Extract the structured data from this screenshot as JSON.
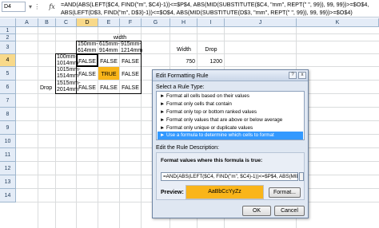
{
  "formula_bar": {
    "name_box": "D4",
    "fx": "fx",
    "formula": "=AND(ABS(LEFT($C4, FIND(\"m\", $C4)-1))<=$P$4, ABS(MID(SUBSTITUTE($C4, \"mm\", REPT(\" \", 99)), 99, 99))>=$O$4, ABS(LEFT(D$3, FIND(\"m\", D$3)-1))<=$O$4, ABS(MID(SUBSTITUTE(D$3, \"mm\", REPT(\" \", 99)), 99, 99))>=$O$4)"
  },
  "columns": [
    "A",
    "B",
    "C",
    "D",
    "E",
    "F",
    "G",
    "H",
    "I",
    "J",
    "K"
  ],
  "rows": [
    "1",
    "2",
    "3",
    "4",
    "5",
    "6",
    "7",
    "8",
    "9",
    "10",
    "11",
    "12",
    "13",
    "14"
  ],
  "cells": {
    "e2": "width",
    "d3": "150mm-\n614mm",
    "e3": "615mm-\n914mm",
    "f3": "915mm-\n1214mm",
    "c4": "100mm-\n1014mm",
    "d4": "FALSE",
    "e4": "FALSE",
    "f4": "FALSE",
    "h4": "750",
    "i4": "1200",
    "h3": "Width",
    "i3": "Drop",
    "c5": "1015mm-\n1514mm",
    "d5": "FALSE",
    "e5": "TRUE",
    "f5": "FALSE",
    "b6": "Drop",
    "c6": "1515mm-\n2014mm",
    "d6": "FALSE",
    "e6": "FALSE",
    "f6": "FALSE"
  },
  "dialog": {
    "title": "Edit Formatting Rule",
    "help": "?",
    "close": "x",
    "select_label": "Select a Rule Type:",
    "rule_types": [
      "► Format all cells based on their values",
      "► Format only cells that contain",
      "► Format only top or bottom ranked values",
      "► Format only values that are above or below average",
      "► Format only unique or duplicate values",
      "► Use a formula to determine which cells to format"
    ],
    "edit_label": "Edit the Rule Description:",
    "formula_label": "Format values where this formula is true:",
    "formula_value": "=AND(ABS(LEFT($C4, FIND(\"m\", $C4)-1))<=$P$4, ABS(MID(",
    "preview_label": "Preview:",
    "preview_sample": "AaBbCcYyZz",
    "format_button": "Format...",
    "ok": "OK",
    "cancel": "Cancel"
  },
  "colors": {
    "highlight": "#f9b51a",
    "selection": "#3399ff"
  }
}
